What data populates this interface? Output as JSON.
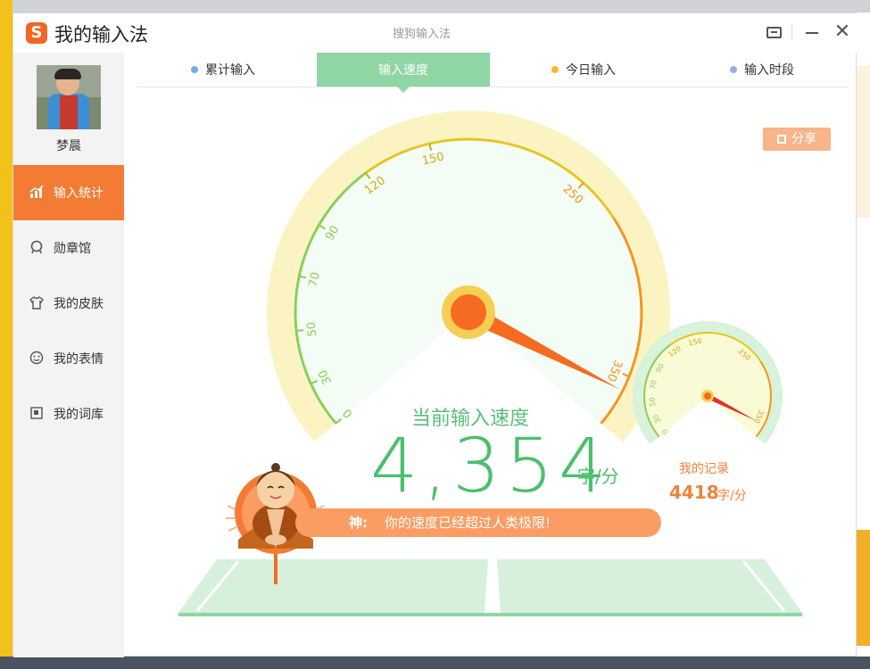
{
  "window": {
    "app_title": "我的输入法",
    "caption": "搜狗输入法",
    "logo_letter": "S"
  },
  "user": {
    "name": "梦晨"
  },
  "sidebar": {
    "items": [
      {
        "label": "输入统计",
        "icon": "chart-icon",
        "active": true
      },
      {
        "label": "勋章馆",
        "icon": "medal-icon",
        "active": false
      },
      {
        "label": "我的皮肤",
        "icon": "tshirt-icon",
        "active": false
      },
      {
        "label": "我的表情",
        "icon": "smiley-icon",
        "active": false
      },
      {
        "label": "我的词库",
        "icon": "book-icon",
        "active": false
      }
    ]
  },
  "tabs": [
    {
      "label": "累计输入",
      "dot": "#6ab0f0",
      "active": false
    },
    {
      "label": "输入速度",
      "dot": "",
      "active": true
    },
    {
      "label": "今日输入",
      "dot": "#f5b92b",
      "active": false
    },
    {
      "label": "输入时段",
      "dot": "#9bb0e0",
      "active": false
    }
  ],
  "share": {
    "label": "分享"
  },
  "gauge": {
    "ticks": [
      "0",
      "30",
      "50",
      "70",
      "90",
      "120",
      "150",
      "250",
      "350"
    ],
    "label": "当前输入速度",
    "value": "4,354",
    "unit": "字/分",
    "needle_value": 350
  },
  "record": {
    "label": "我的记录",
    "value": "4418",
    "unit": "字/分",
    "ticks": [
      "0",
      "30",
      "50",
      "70",
      "90",
      "120",
      "150",
      "250",
      "350"
    ]
  },
  "banner": {
    "title": "神:",
    "text": "你的速度已经超过人类极限!"
  },
  "colors": {
    "accent": "#f47b34",
    "tab_active": "#8fd6a4",
    "speed_text": "#4cbf6c",
    "record_text": "#f0823c"
  }
}
